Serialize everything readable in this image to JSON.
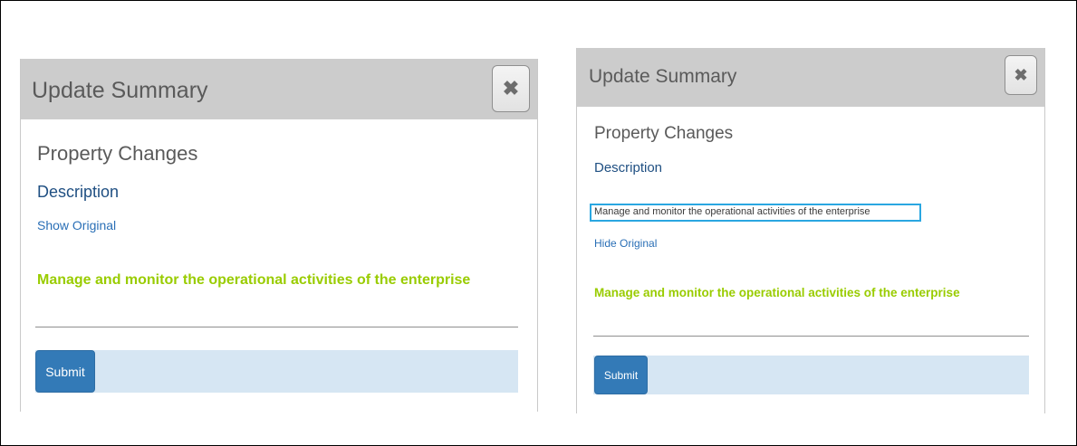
{
  "dialog_before": {
    "title": "Update Summary",
    "close_icon": "close-icon",
    "section_title": "Property Changes",
    "field_label": "Description",
    "toggle_link": "Show Original",
    "new_value": "Manage and monitor the operational activities of the enterprise",
    "submit_label": "Submit"
  },
  "dialog_after": {
    "title": "Update Summary",
    "close_icon": "close-icon",
    "section_title": "Property Changes",
    "field_label": "Description",
    "original_value": "Manage and monitor the operational activities of the enterprise",
    "toggle_link": "Hide Original",
    "new_value": "Manage and monitor the operational activities of the enterprise",
    "submit_label": "Submit"
  },
  "colors": {
    "header_bg": "#cccccc",
    "label_blue": "#1f4f82",
    "link_blue": "#2a6fb6",
    "new_value_green": "#99cc00",
    "highlight_border": "#2aa7e1",
    "submit_bg": "#337ab7",
    "footer_bg": "#d6e6f3"
  }
}
